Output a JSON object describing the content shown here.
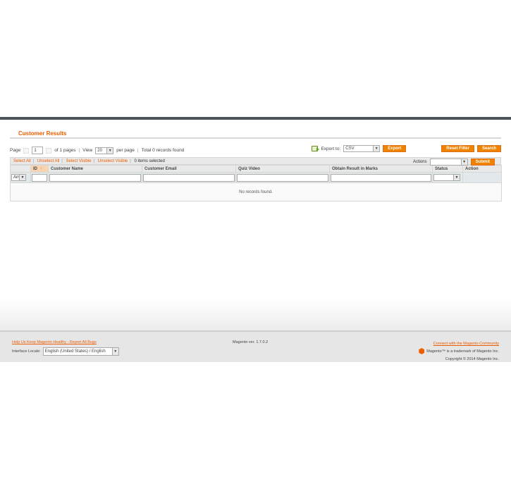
{
  "header": {
    "title": "Customer Results"
  },
  "pager": {
    "page_label": "Page",
    "page_value": "1",
    "of_pages": "of 1 pages",
    "view_label": "View",
    "view_value": "20",
    "per_page": "per page",
    "total": "Total 0 records found",
    "export_label": "Export to:",
    "export_format": "CSV",
    "export_button": "Export",
    "reset_button": "Reset Filter",
    "search_button": "Search"
  },
  "massaction": {
    "select_all": "Select All",
    "unselect_all": "Unselect All",
    "select_visible": "Select Visible",
    "unselect_visible": "Unselect Visible",
    "items_selected": "0 items selected",
    "actions_label": "Actions",
    "submit_button": "Submit"
  },
  "grid": {
    "columns": [
      "",
      "ID",
      "Customer Name",
      "Customer Email",
      "Quiz Video",
      "Obtain Result in Marks",
      "Status",
      "Action"
    ],
    "any_option": "Any",
    "empty_text": "No records found."
  },
  "footer": {
    "help_link": "Help Us Keep Magento Healthy - Report All Bugs",
    "locale_label": "Interface Locale:",
    "locale_value": "English (United States) / English",
    "version": "Magento ver. 1.7.0.2",
    "community_link": "Connect with the Magento Community",
    "trademark": "Magento™ is a trademark of Magento Inc.",
    "copyright": "Copyright © 2014 Magento Inc."
  }
}
